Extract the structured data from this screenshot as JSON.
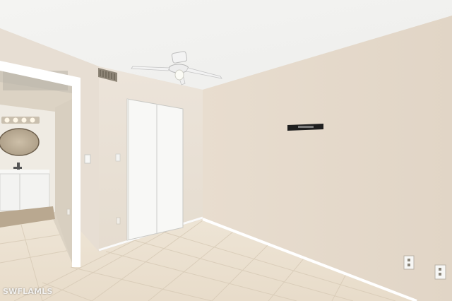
{
  "watermark": {
    "text": "SWFLAMLS"
  },
  "scene": {
    "description_icons": [
      "ceiling-fan-icon",
      "air-vent-icon",
      "light-switch-icon",
      "wall-outlet-icon",
      "vanity-sink-icon"
    ],
    "colors": {
      "ceiling": "#f3f3f1",
      "wall_right": "#e6dbcd",
      "wall_back": "#e9e1d6",
      "floor_tile": "#ede3d3",
      "closet_door": "#f7f7f5",
      "trim": "#ffffff"
    }
  }
}
